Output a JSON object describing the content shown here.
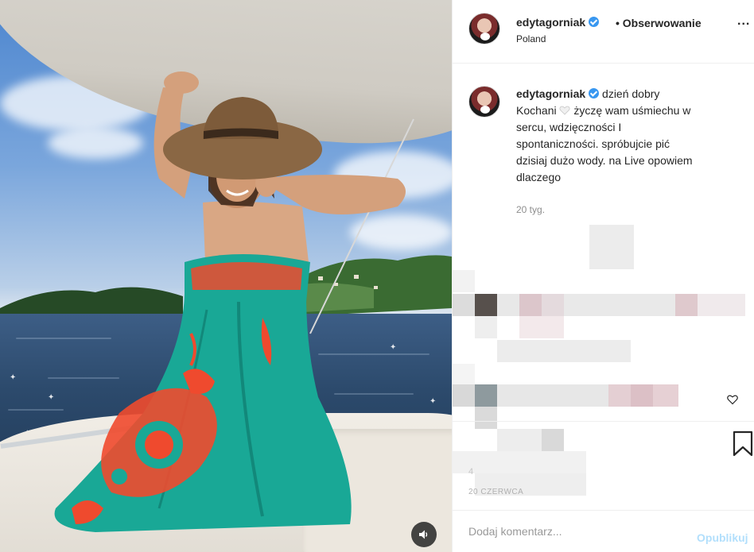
{
  "post": {
    "username": "edytagorniak",
    "separator": "•",
    "follow_label": "Obserwowanie",
    "location": "Poland",
    "more_label": "...",
    "caption": {
      "line1": "dzień dobry",
      "line2a": "Kochani",
      "line2b": "życzę wam uśmiechu w",
      "line3": "sercu, wdzięczności I",
      "line4": "spontaniczności. spróbujcie pić",
      "line5": "dzisiaj dużo wody. na Live opowiem",
      "line6": "dlaczego"
    },
    "caption_time": "20 tyg.",
    "bottom_time": "20 CZERWCA",
    "partial_digit": "4"
  },
  "comment": {
    "placeholder": "Dodaj komentarz...",
    "publish_label": "Opublikuj"
  },
  "icons": {
    "verified": "verified-badge-icon",
    "like": "heart-icon",
    "bookmark": "bookmark-icon",
    "sound": "speaker-muted-icon",
    "white_heart": "white-heart-emoji-icon"
  },
  "colors": {
    "verified": "#3897f0",
    "publish_disabled": "#b2dffc",
    "dress_teal": "#19a896",
    "embroidery": "#ef4a2e",
    "hat": "#8a6744"
  }
}
